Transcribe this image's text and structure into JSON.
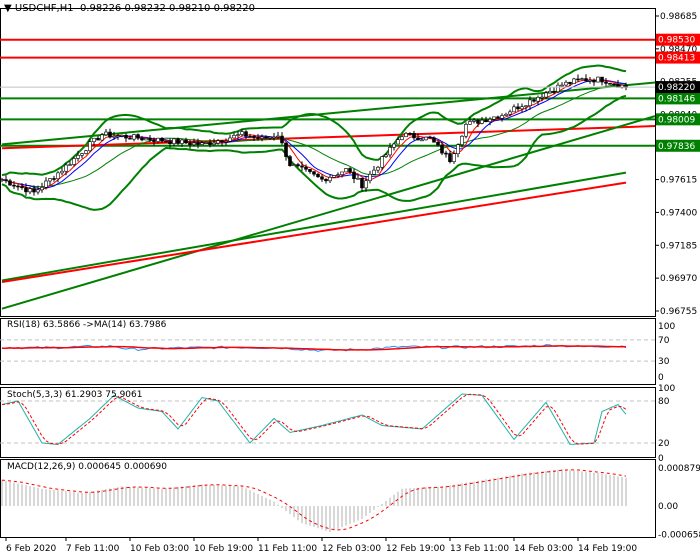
{
  "header": {
    "symbol": "USDCHF,H1",
    "open": "0.98226",
    "high": "0.98232",
    "low": "0.98210",
    "close": "0.98220"
  },
  "price_axis": [
    "0.98685",
    "0.98470",
    "0.98255",
    "0.98040",
    "0.97615",
    "0.97400",
    "0.97185",
    "0.96970",
    "0.96755"
  ],
  "levels": [
    {
      "label": "0.98530",
      "price": 0.9853,
      "color": "#ff0000"
    },
    {
      "label": "0.98413",
      "price": 0.98413,
      "color": "#ff0000"
    },
    {
      "label": "0.98146",
      "price": 0.98146,
      "color": "#008000"
    },
    {
      "label": "0.98009",
      "price": 0.98009,
      "color": "#008000"
    },
    {
      "label": "0.97836",
      "price": 0.97836,
      "color": "#008000"
    }
  ],
  "current_price": {
    "label": "0.98220",
    "price": 0.9822
  },
  "rsi": {
    "title": "RSI(18) 63.5866  ->MA(14) 63.7986",
    "axis": [
      "100",
      "70",
      "30",
      "0"
    ]
  },
  "stoch": {
    "title": "Stoch(5,3,3) 61.2903 75.9061",
    "axis": [
      "100",
      "80",
      "20",
      "0"
    ]
  },
  "macd": {
    "title": "MACD(12,26,9) 0.000645 0.000690",
    "axis": [
      "0.000879",
      "0.00",
      "-0.000658"
    ]
  },
  "time_axis": [
    {
      "bar": 1,
      "label": "6 Feb 2020"
    },
    {
      "bar": 16,
      "label": "7 Feb 11:00"
    },
    {
      "bar": 32,
      "label": "10 Feb 03:00"
    },
    {
      "bar": 48,
      "label": "10 Feb 19:00"
    },
    {
      "bar": 64,
      "label": "11 Feb 11:00"
    },
    {
      "bar": 80,
      "label": "12 Feb 03:00"
    },
    {
      "bar": 96,
      "label": "12 Feb 19:00"
    },
    {
      "bar": 112,
      "label": "13 Feb 11:00"
    },
    {
      "bar": 128,
      "label": "14 Feb 03:00"
    },
    {
      "bar": 144,
      "label": "14 Feb 19:00"
    }
  ],
  "chart_data": {
    "type": "line",
    "title": "USDCHF,H1",
    "ylim": [
      0.96755,
      0.98685
    ],
    "bars": 157,
    "close_keypoints": [
      [
        0,
        0.97615
      ],
      [
        8,
        0.9753
      ],
      [
        15,
        0.9768
      ],
      [
        22,
        0.97845
      ],
      [
        25,
        0.9791
      ],
      [
        37,
        0.9788
      ],
      [
        50,
        0.97845
      ],
      [
        60,
        0.9791
      ],
      [
        65,
        0.9788
      ],
      [
        69,
        0.9791
      ],
      [
        72,
        0.97715
      ],
      [
        80,
        0.97615
      ],
      [
        86,
        0.9768
      ],
      [
        90,
        0.9758
      ],
      [
        95,
        0.97745
      ],
      [
        100,
        0.9791
      ],
      [
        107,
        0.9788
      ],
      [
        112,
        0.97745
      ],
      [
        116,
        0.97975
      ],
      [
        125,
        0.9804
      ],
      [
        135,
        0.9817
      ],
      [
        140,
        0.98235
      ],
      [
        145,
        0.9827
      ],
      [
        150,
        0.9827
      ],
      [
        156,
        0.9822
      ]
    ],
    "trendlines": [
      {
        "color": "#ff0000",
        "p0": 0.9782,
        "p1": 0.97965,
        "b0": 0,
        "b1": 164
      },
      {
        "color": "#008000",
        "p0": 0.9677,
        "p1": 0.9803,
        "b0": 0,
        "b1": 164
      },
      {
        "color": "#008000",
        "p0": 0.96955,
        "p1": 0.9766,
        "b0": 0,
        "b1": 156
      },
      {
        "color": "#ff0000",
        "p0": 0.96945,
        "p1": 0.97595,
        "b0": 0,
        "b1": 156
      },
      {
        "color": "#008000",
        "p0": 0.97845,
        "p1": 0.9825,
        "b0": 0,
        "b1": 164
      }
    ],
    "rsi_keypoints": [
      [
        0,
        56
      ],
      [
        10,
        55
      ],
      [
        20,
        57
      ],
      [
        28,
        58
      ],
      [
        32,
        52
      ],
      [
        45,
        55
      ],
      [
        60,
        56
      ],
      [
        70,
        55
      ],
      [
        80,
        50
      ],
      [
        90,
        52
      ],
      [
        100,
        57
      ],
      [
        110,
        56
      ],
      [
        120,
        57
      ],
      [
        130,
        58
      ],
      [
        138,
        60
      ],
      [
        145,
        57
      ],
      [
        150,
        58
      ],
      [
        156,
        58
      ]
    ],
    "stoch_keypoints": [
      [
        0,
        75
      ],
      [
        4,
        80
      ],
      [
        10,
        20
      ],
      [
        14,
        18
      ],
      [
        22,
        55
      ],
      [
        28,
        88
      ],
      [
        34,
        70
      ],
      [
        40,
        65
      ],
      [
        44,
        40
      ],
      [
        50,
        85
      ],
      [
        54,
        80
      ],
      [
        62,
        20
      ],
      [
        68,
        55
      ],
      [
        72,
        35
      ],
      [
        80,
        45
      ],
      [
        90,
        60
      ],
      [
        95,
        45
      ],
      [
        105,
        40
      ],
      [
        115,
        90
      ],
      [
        120,
        88
      ],
      [
        128,
        25
      ],
      [
        136,
        78
      ],
      [
        142,
        18
      ],
      [
        148,
        20
      ],
      [
        150,
        65
      ],
      [
        154,
        75
      ],
      [
        156,
        61
      ]
    ],
    "macd_keypoints": [
      [
        0,
        0.0006
      ],
      [
        10,
        0.0004
      ],
      [
        20,
        0.0003
      ],
      [
        30,
        0.00045
      ],
      [
        40,
        0.0004
      ],
      [
        50,
        0.0005
      ],
      [
        60,
        0.00045
      ],
      [
        68,
        0.0001
      ],
      [
        75,
        -0.0004
      ],
      [
        82,
        -0.0006
      ],
      [
        90,
        -0.0003
      ],
      [
        100,
        0.0004
      ],
      [
        110,
        0.00045
      ],
      [
        120,
        0.0006
      ],
      [
        130,
        0.00075
      ],
      [
        140,
        0.00085
      ],
      [
        150,
        0.00075
      ],
      [
        156,
        0.00065
      ]
    ]
  }
}
